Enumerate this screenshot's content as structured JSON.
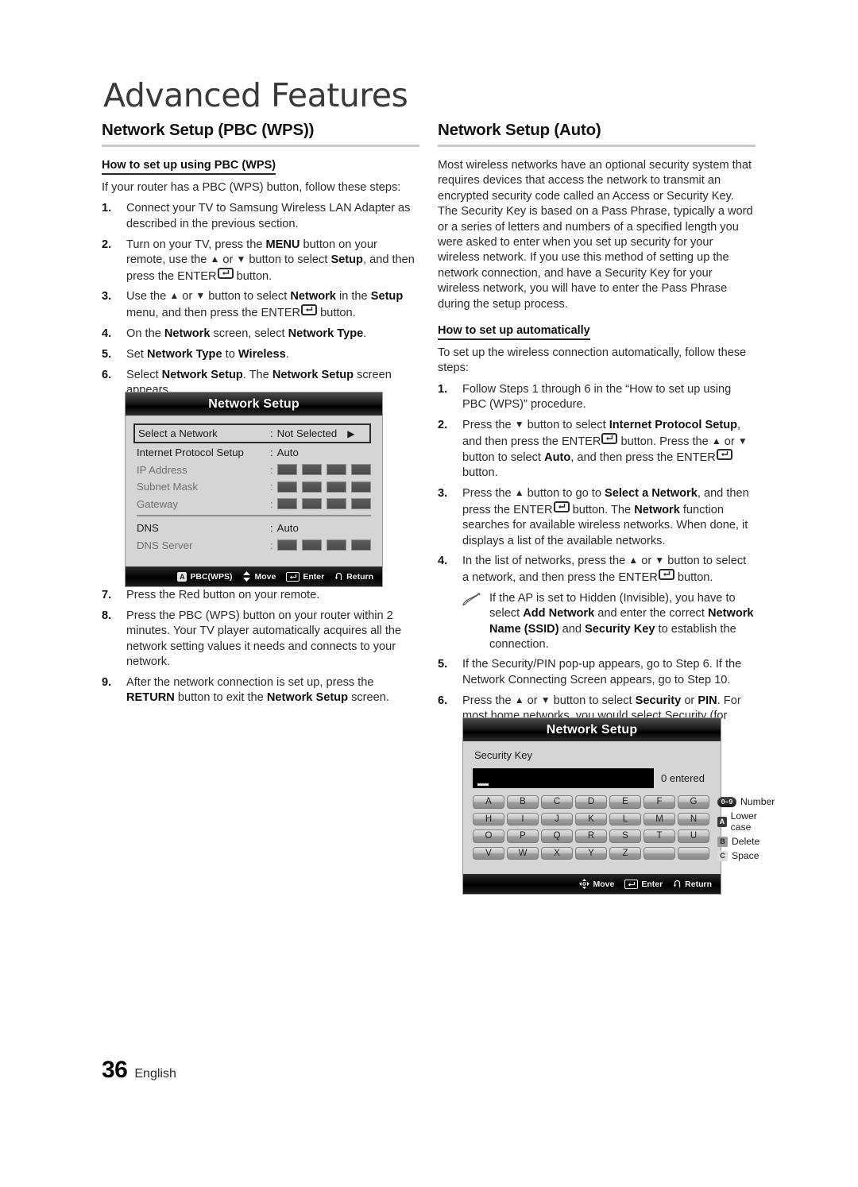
{
  "chapter": {
    "title": "Advanced Features"
  },
  "footer": {
    "page_number": "36",
    "language": "English"
  },
  "left_column": {
    "section_heading": "Network Setup (PBC (WPS))",
    "sub_heading": "How to set up using PBC (WPS)",
    "intro": "If your router has a PBC (WPS) button, follow these steps:",
    "steps": [
      {
        "num": "1.",
        "text_html": "Connect your TV to Samsung Wireless LAN Adapter as described in the previous section."
      },
      {
        "num": "2.",
        "text_html": "Turn on your TV, press the <b>MENU</b> button on your remote, use the <span class=\"arrow\">&#9650;</span> or <span class=\"arrow\">&#9660;</span> button to select <b>Setup</b>, and then press the ENTER<span class=\"enter-key\"><svg width=\"11\" height=\"9\" viewBox=\"0 0 11 9\"><path d=\"M9.5 1 V5 H3\" stroke=\"#2b2b2b\" stroke-width=\"1.4\" fill=\"none\"/><path d=\"M4.4 2.6 L2 5 L4.4 7.4 Z\" fill=\"#2b2b2b\"/></svg></span> button."
      },
      {
        "num": "3.",
        "text_html": "Use the <span class=\"arrow\">&#9650;</span> or <span class=\"arrow\">&#9660;</span> button to select <b>Network</b> in the <b>Setup</b> menu, and then press the ENTER<span class=\"enter-key\"><svg width=\"11\" height=\"9\" viewBox=\"0 0 11 9\"><path d=\"M9.5 1 V5 H3\" stroke=\"#2b2b2b\" stroke-width=\"1.4\" fill=\"none\"/><path d=\"M4.4 2.6 L2 5 L4.4 7.4 Z\" fill=\"#2b2b2b\"/></svg></span> button."
      },
      {
        "num": "4.",
        "text_html": "On the <b>Network</b> screen, select <b>Network Type</b>."
      },
      {
        "num": "5.",
        "text_html": "Set <b>Network Type</b> to <b>Wireless</b>."
      },
      {
        "num": "6.",
        "text_html": "Select <b>Network Setup</b>. The <b>Network Setup</b> screen appears."
      }
    ],
    "steps_after_figure": [
      {
        "num": "7.",
        "text_html": "Press the Red button on your remote."
      },
      {
        "num": "8.",
        "text_html": "Press the PBC (WPS) button on your router within 2 minutes. Your TV player automatically acquires all the network setting values it needs and connects to your network."
      },
      {
        "num": "9.",
        "text_html": "After the network connection is set up, press the <b>RETURN</b> button to exit the <b>Network Setup</b> screen."
      }
    ]
  },
  "right_column": {
    "section_heading": "Network Setup (Auto)",
    "intro": "Most wireless networks have an optional security system that requires devices that access the network to transmit an encrypted security code called an Access or Security Key. The Security Key is based on a Pass Phrase, typically a word or a series of letters and numbers of a specified length you were asked to enter when you set up security for your wireless network.  If you use this method of setting up the network connection, and have a Security Key for your wireless network, you will have to enter the Pass Phrase during the setup process.",
    "sub_heading": "How to set up automatically",
    "intro2": "To set up the wireless connection automatically, follow these steps:",
    "steps": [
      {
        "num": "1.",
        "text_html": "Follow Steps 1 through 6 in the “How to set up using PBC (WPS)” procedure."
      },
      {
        "num": "2.",
        "text_html": "Press the <span class=\"arrow\">&#9660;</span> button to select <b>Internet Protocol Setup</b>, and then press the ENTER<span class=\"enter-key\"><svg width=\"11\" height=\"9\" viewBox=\"0 0 11 9\"><path d=\"M9.5 1 V5 H3\" stroke=\"#2b2b2b\" stroke-width=\"1.4\" fill=\"none\"/><path d=\"M4.4 2.6 L2 5 L4.4 7.4 Z\" fill=\"#2b2b2b\"/></svg></span> button. Press the <span class=\"arrow\">&#9650;</span> or <span class=\"arrow\">&#9660;</span> button to select <b>Auto</b>, and then press the ENTER<span class=\"enter-key\"><svg width=\"11\" height=\"9\" viewBox=\"0 0 11 9\"><path d=\"M9.5 1 V5 H3\" stroke=\"#2b2b2b\" stroke-width=\"1.4\" fill=\"none\"/><path d=\"M4.4 2.6 L2 5 L4.4 7.4 Z\" fill=\"#2b2b2b\"/></svg></span> button."
      },
      {
        "num": "3.",
        "text_html": "Press the <span class=\"arrow\">&#9650;</span> button to go to <b>Select a Network</b>, and then press the ENTER<span class=\"enter-key\"><svg width=\"11\" height=\"9\" viewBox=\"0 0 11 9\"><path d=\"M9.5 1 V5 H3\" stroke=\"#2b2b2b\" stroke-width=\"1.4\" fill=\"none\"/><path d=\"M4.4 2.6 L2 5 L4.4 7.4 Z\" fill=\"#2b2b2b\"/></svg></span> button. The <b>Network</b> function searches for available wireless networks. When done, it displays a list of the available networks."
      },
      {
        "num": "4.",
        "text_html": "In the list of networks, press the <span class=\"arrow\">&#9650;</span> or <span class=\"arrow\">&#9660;</span> button to select a network, and then press the ENTER<span class=\"enter-key\"><svg width=\"11\" height=\"9\" viewBox=\"0 0 11 9\"><path d=\"M9.5 1 V5 H3\" stroke=\"#2b2b2b\" stroke-width=\"1.4\" fill=\"none\"/><path d=\"M4.4 2.6 L2 5 L4.4 7.4 Z\" fill=\"#2b2b2b\"/></svg></span> button."
      }
    ],
    "note": "If the AP is set to Hidden (Invisible), you have to select <b>Add Network</b> and enter the correct <b>Network Name (SSID)</b> and <b>Security Key</b> to establish the connection.",
    "steps2": [
      {
        "num": "5.",
        "text_html": "If the Security/PIN pop-up appears, go to Step 6. If the Network Connecting Screen appears, go to Step 10."
      },
      {
        "num": "6.",
        "text_html": "Press the <span class=\"arrow\">&#9650;</span> or <span class=\"arrow\">&#9660;</span> button to select <b>Security</b> or <b>PIN</b>. For most home networks, you would select Security (for <b>Security Key</b>). The <b>Security</b> Screen appears."
      }
    ]
  },
  "osd_network_setup": {
    "title": "Network Setup",
    "rows": [
      {
        "label": "Select a Network",
        "value": "Not Selected",
        "type": "selected"
      },
      {
        "label": "Internet Protocol Setup",
        "value": "Auto",
        "type": "normal"
      },
      {
        "label": "IP Address",
        "value": "",
        "type": "cells"
      },
      {
        "label": "Subnet Mask",
        "value": "",
        "type": "cells"
      },
      {
        "label": "Gateway",
        "value": "",
        "type": "cells"
      },
      {
        "label": "DNS",
        "value": "Auto",
        "type": "normal"
      },
      {
        "label": "DNS Server",
        "value": "",
        "type": "cells"
      }
    ],
    "footer": [
      {
        "icon": "a-button-icon",
        "label": "PBC(WPS)"
      },
      {
        "icon": "up-down-arrows-icon",
        "label": "Move"
      },
      {
        "icon": "enter-key-icon",
        "label": "Enter"
      },
      {
        "icon": "return-arrow-icon",
        "label": "Return"
      }
    ]
  },
  "osd_security_key": {
    "title": "Network Setup",
    "field_label": "Security Key",
    "entered_count": "0 entered",
    "keys": [
      "A",
      "B",
      "C",
      "D",
      "E",
      "F",
      "G",
      "H",
      "I",
      "J",
      "K",
      "L",
      "M",
      "N",
      "O",
      "P",
      "Q",
      "R",
      "S",
      "T",
      "U",
      "V",
      "W",
      "X",
      "Y",
      "Z",
      "",
      ""
    ],
    "legend": [
      {
        "icon": "number-button-icon",
        "badge": "0~9",
        "label": "Number"
      },
      {
        "icon": "a-button-icon",
        "badge": "A",
        "label": "Lower case"
      },
      {
        "icon": "b-button-icon",
        "badge": "B",
        "label": "Delete"
      },
      {
        "icon": "c-button-icon",
        "badge": "C",
        "label": "Space"
      }
    ],
    "footer": [
      {
        "icon": "dpad-icon",
        "label": "Move"
      },
      {
        "icon": "enter-key-icon",
        "label": "Enter"
      },
      {
        "icon": "return-arrow-icon",
        "label": "Return"
      }
    ]
  },
  "colors": {
    "rule": "#c9c9c9",
    "text": "#2b2b2b",
    "osd_background": "#d5d5d5",
    "osd_titlebar": "#000000"
  }
}
